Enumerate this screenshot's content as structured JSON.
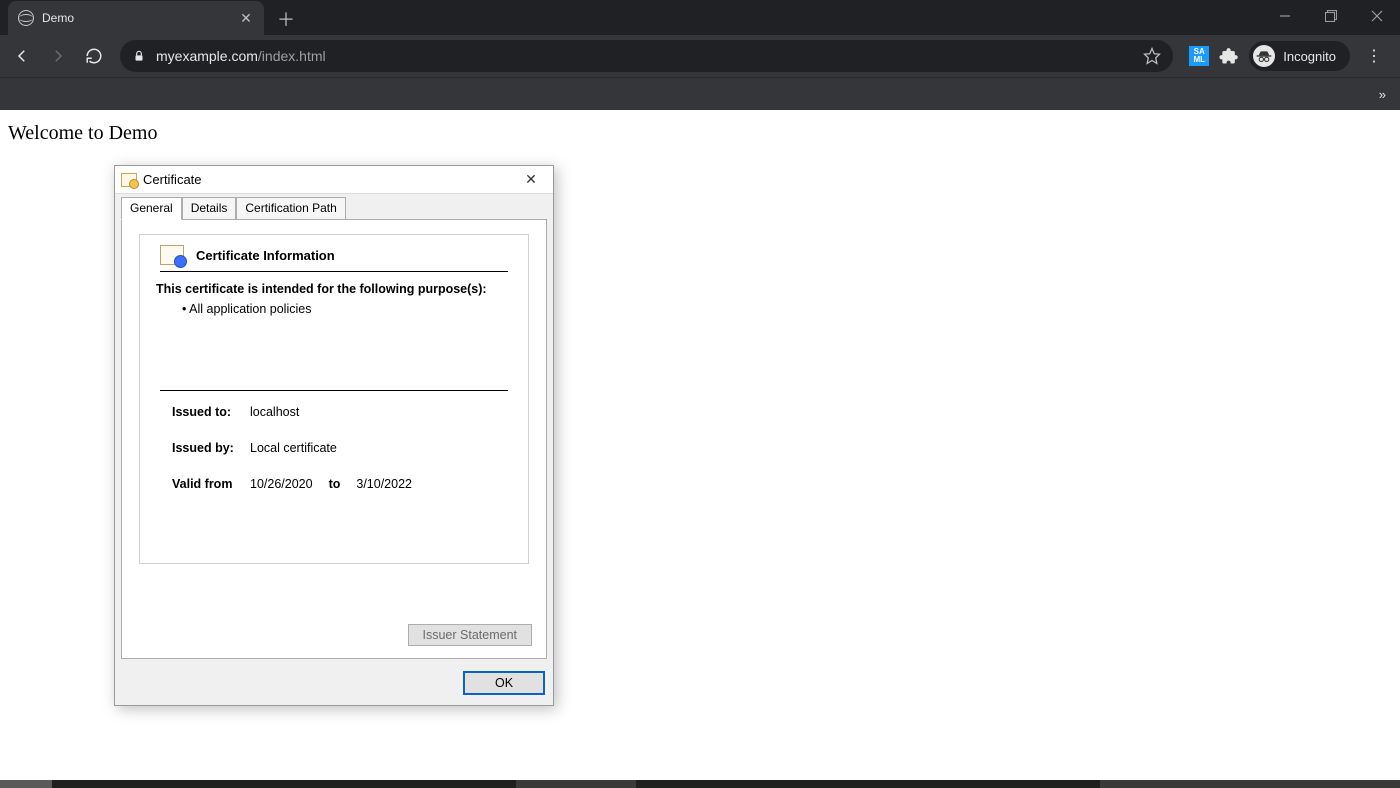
{
  "browser": {
    "tab_title": "Demo",
    "url_host": "myexample.com",
    "url_path": "/index.html",
    "incognito_label": "Incognito",
    "saml_badge": "SA\nML"
  },
  "page": {
    "heading": "Welcome to Demo"
  },
  "cert": {
    "title": "Certificate",
    "tabs": {
      "general": "General",
      "details": "Details",
      "path": "Certification Path"
    },
    "info_heading": "Certificate Information",
    "intro": "This certificate is intended for the following purpose(s):",
    "purposes": [
      "All application policies"
    ],
    "issued_to_label": "Issued to:",
    "issued_to_value": "localhost",
    "issued_by_label": "Issued by:",
    "issued_by_value": "Local certificate",
    "valid_from_label": "Valid from",
    "valid_from": "10/26/2020",
    "valid_to_sep": "to",
    "valid_to": "3/10/2022",
    "issuer_statement_btn": "Issuer Statement",
    "ok_btn": "OK"
  }
}
